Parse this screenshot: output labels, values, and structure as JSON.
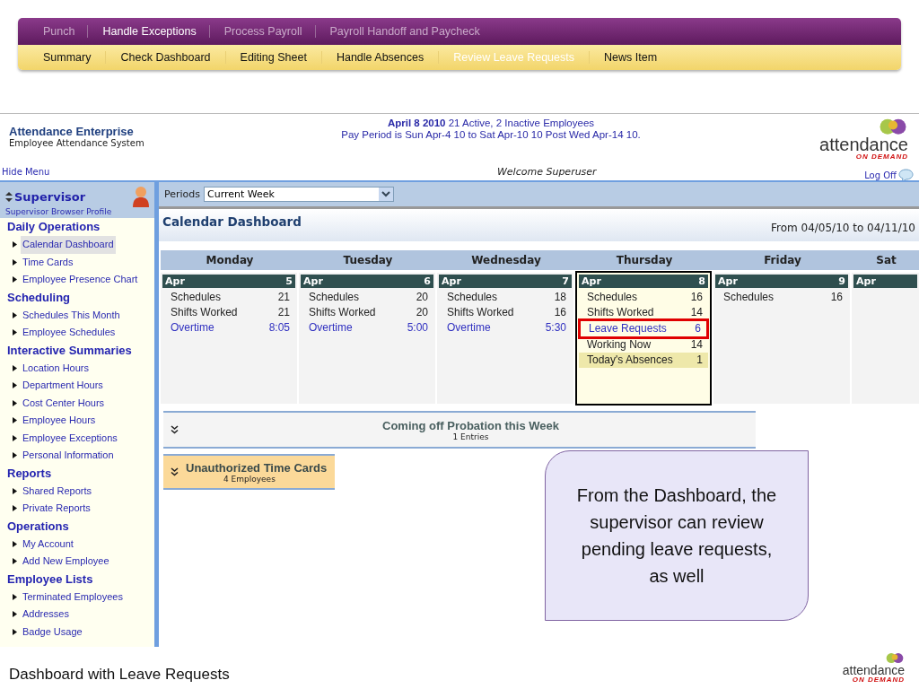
{
  "nav": {
    "top_tabs": [
      {
        "label": "Punch",
        "selected": false
      },
      {
        "label": "Handle Exceptions",
        "selected": true
      },
      {
        "label": "Process Payroll",
        "selected": false
      },
      {
        "label": "Payroll Handoff and Paycheck",
        "selected": false
      }
    ],
    "sub_tabs": [
      {
        "label": "Summary",
        "selected": false
      },
      {
        "label": "Check Dashboard",
        "selected": false
      },
      {
        "label": "Editing Sheet",
        "selected": false
      },
      {
        "label": "Handle Absences",
        "selected": false
      },
      {
        "label": "Review Leave Requests",
        "selected": true
      },
      {
        "label": "News Item",
        "selected": false
      }
    ]
  },
  "header": {
    "brand_title": "Attendance Enterprise",
    "brand_subtitle": "Employee Attendance System",
    "status": "**April 8 2010** 21 Active, 2 Inactive Employees",
    "pay_period": "Pay Period is Sun Apr-4 10 to Sat Apr-10 10 Post Wed Apr-14 10.",
    "logo_word": "attendance",
    "logo_tag": "ON DEMAND",
    "hide_menu": "Hide Menu",
    "welcome": "Welcome Superuser",
    "log_off": "Log Off"
  },
  "sidebar": {
    "title": "Supervisor",
    "profile": "Supervisor Browser Profile",
    "sections": [
      {
        "heading": "Daily Operations",
        "items": [
          {
            "label": "Calendar Dashboard",
            "selected": true
          },
          {
            "label": "Time Cards",
            "selected": false
          },
          {
            "label": "Employee Presence Chart",
            "selected": false
          }
        ]
      },
      {
        "heading": "Scheduling",
        "items": [
          {
            "label": "Schedules This Month",
            "selected": false
          },
          {
            "label": "Employee Schedules",
            "selected": false
          }
        ]
      },
      {
        "heading": "Interactive Summaries",
        "items": [
          {
            "label": "Location Hours",
            "selected": false
          },
          {
            "label": "Department Hours",
            "selected": false
          },
          {
            "label": "Cost Center Hours",
            "selected": false
          },
          {
            "label": "Employee Hours",
            "selected": false
          },
          {
            "label": "Employee Exceptions",
            "selected": false
          },
          {
            "label": "Personal Information",
            "selected": false
          }
        ]
      },
      {
        "heading": "Reports",
        "items": [
          {
            "label": "Shared Reports",
            "selected": false
          },
          {
            "label": "Private Reports",
            "selected": false
          }
        ]
      },
      {
        "heading": "Operations",
        "items": [
          {
            "label": "My Account",
            "selected": false
          },
          {
            "label": "Add New Employee",
            "selected": false
          }
        ]
      },
      {
        "heading": "Employee Lists",
        "items": [
          {
            "label": "Terminated Employees",
            "selected": false
          },
          {
            "label": "Addresses",
            "selected": false
          },
          {
            "label": "Badge Usage",
            "selected": false
          }
        ]
      }
    ]
  },
  "periods": {
    "label": "Periods",
    "value": "Current Week"
  },
  "dashboard": {
    "title": "Calendar Dashboard",
    "range": "From 04/05/10 to 04/11/10",
    "days": [
      {
        "name": "Monday",
        "month": "Apr",
        "date": "5",
        "selected": false,
        "rows": [
          {
            "label": "Schedules",
            "value": "21",
            "kind": "plain",
            "boxed": false
          },
          {
            "label": "Shifts Worked",
            "value": "21",
            "kind": "plain",
            "boxed": false
          },
          {
            "label": "Overtime",
            "value": "8:05",
            "kind": "link",
            "boxed": false
          }
        ]
      },
      {
        "name": "Tuesday",
        "month": "Apr",
        "date": "6",
        "selected": false,
        "rows": [
          {
            "label": "Schedules",
            "value": "20",
            "kind": "plain",
            "boxed": false
          },
          {
            "label": "Shifts Worked",
            "value": "20",
            "kind": "plain",
            "boxed": false
          },
          {
            "label": "Overtime",
            "value": "5:00",
            "kind": "link",
            "boxed": false
          }
        ]
      },
      {
        "name": "Wednesday",
        "month": "Apr",
        "date": "7",
        "selected": false,
        "rows": [
          {
            "label": "Schedules",
            "value": "18",
            "kind": "plain",
            "boxed": false
          },
          {
            "label": "Shifts Worked",
            "value": "16",
            "kind": "plain",
            "boxed": false
          },
          {
            "label": "Overtime",
            "value": "5:30",
            "kind": "link",
            "boxed": false
          }
        ]
      },
      {
        "name": "Thursday",
        "month": "Apr",
        "date": "8",
        "selected": true,
        "rows": [
          {
            "label": "Schedules",
            "value": "16",
            "kind": "plain",
            "boxed": false
          },
          {
            "label": "Shifts Worked",
            "value": "14",
            "kind": "plain",
            "boxed": false
          },
          {
            "label": "Leave Requests",
            "value": "6",
            "kind": "link",
            "boxed": true
          },
          {
            "label": "Working Now",
            "value": "14",
            "kind": "plain",
            "boxed": false
          },
          {
            "label": "Today's Absences",
            "value": "1",
            "kind": "absence",
            "boxed": false
          }
        ]
      },
      {
        "name": "Friday",
        "month": "Apr",
        "date": "9",
        "selected": false,
        "rows": [
          {
            "label": "Schedules",
            "value": "16",
            "kind": "plain",
            "boxed": false
          }
        ]
      },
      {
        "name": "Sat",
        "month": "Apr",
        "selected": false
      }
    ]
  },
  "panels": [
    {
      "title": "Coming off Probation this Week",
      "subtitle": "1 Entries",
      "kind": "wide"
    },
    {
      "title": "Unauthorized Time Cards",
      "subtitle": "4 Employees",
      "kind": "alert"
    }
  ],
  "callout": "From the Dashboard, the supervisor can review pending leave requests, as well",
  "footer": {
    "caption": "Dashboard with Leave Requests",
    "logo_word": "attendance",
    "logo_tag": "ON DEMAND"
  }
}
